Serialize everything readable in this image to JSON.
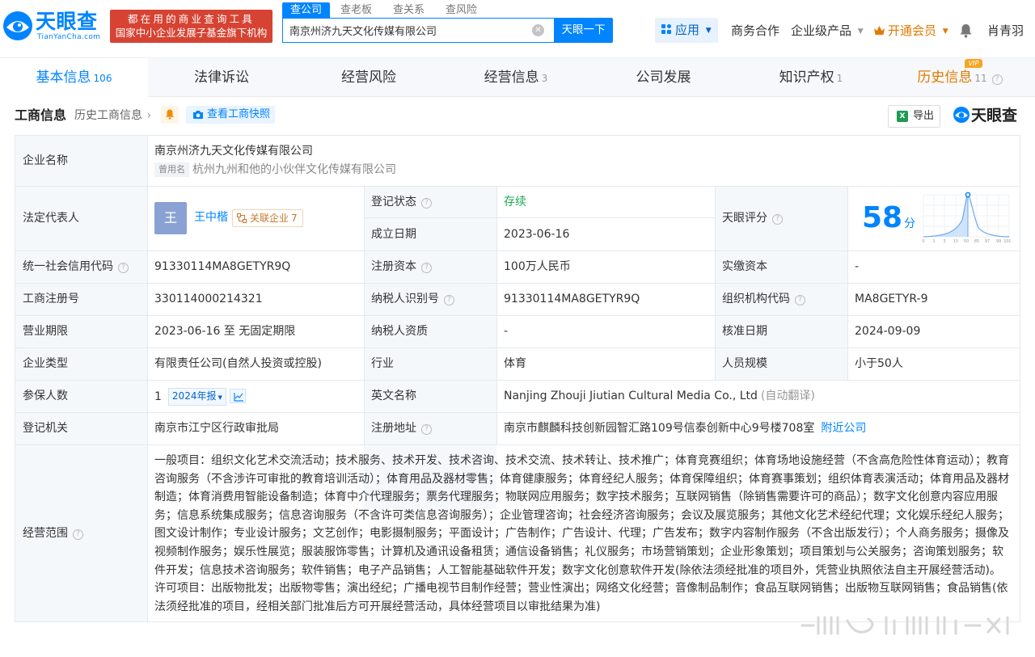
{
  "header": {
    "logo_text": "天眼查",
    "logo_sub": "TianYanCha.com",
    "slogan_line1": "都在用的商业查询工具",
    "slogan_line2": "国家中小企业发展子基金旗下机构",
    "search_tabs": [
      "查公司",
      "查老板",
      "查关系",
      "查风险"
    ],
    "search_value": "南京州济九天文化传媒有限公司",
    "search_button": "天眼一下",
    "nav": {
      "apps": "应用",
      "business": "商务合作",
      "enterprise": "企业级产品",
      "vip": "开通会员",
      "user": "肖青羽"
    }
  },
  "tabs": [
    {
      "label": "基本信息",
      "count": "106"
    },
    {
      "label": "法律诉讼",
      "count": ""
    },
    {
      "label": "经营风险",
      "count": ""
    },
    {
      "label": "经营信息",
      "count": "3"
    },
    {
      "label": "公司发展",
      "count": ""
    },
    {
      "label": "知识产权",
      "count": "1"
    },
    {
      "label": "历史信息",
      "count": "11"
    }
  ],
  "vip_badge": "VIP",
  "section": {
    "title": "工商信息",
    "history": "历史工商信息",
    "snapshot": "查看工商快照",
    "export": "导出",
    "export_icon": "X",
    "brand": "天眼查"
  },
  "info": {
    "company_name_label": "企业名称",
    "company_name": "南京州济九天文化传媒有限公司",
    "former_name_tag": "曾用名",
    "former_name": "杭州九州和他的小伙伴文化传媒有限公司",
    "legal_rep_label": "法定代表人",
    "legal_rep_avatar": "王",
    "legal_rep": "王中楷",
    "related_label": "关联企业",
    "related_count": "7",
    "reg_status_label": "登记状态",
    "reg_status": "存续",
    "est_date_label": "成立日期",
    "est_date": "2023-06-16",
    "score_label": "天眼评分",
    "score": "58",
    "score_unit": "分",
    "score_axis": [
      "0",
      "1",
      "3",
      "15",
      "50",
      "85",
      "97",
      "99",
      "100"
    ],
    "credit_code_label": "统一社会信用代码",
    "credit_code": "91330114MA8GETYR9Q",
    "reg_capital_label": "注册资本",
    "reg_capital": "100万人民币",
    "paid_capital_label": "实缴资本",
    "paid_capital": "-",
    "reg_no_label": "工商注册号",
    "reg_no": "330114000214321",
    "taxpayer_id_label": "纳税人识别号",
    "taxpayer_id": "91330114MA8GETYR9Q",
    "org_code_label": "组织机构代码",
    "org_code": "MA8GETYR-9",
    "term_label": "营业期限",
    "term": "2023-06-16 至 无固定期限",
    "taxpayer_qual_label": "纳税人资质",
    "taxpayer_qual": "-",
    "approval_date_label": "核准日期",
    "approval_date": "2024-09-09",
    "type_label": "企业类型",
    "type": "有限责任公司(自然人投资或控股)",
    "industry_label": "行业",
    "industry": "体育",
    "staff_label": "人员规模",
    "staff": "小于50人",
    "insured_label": "参保人数",
    "insured": "1",
    "insured_report": "2024年报",
    "english_label": "英文名称",
    "english": "Nanjing Zhouji Jiutian Cultural Media Co., Ltd",
    "english_note": "(自动翻译)",
    "authority_label": "登记机关",
    "authority": "南京市江宁区行政审批局",
    "address_label": "注册地址",
    "address": "南京市麒麟科技创新园智汇路109号信泰创新中心9号楼708室",
    "nearby": "附近公司",
    "scope_label": "经营范围",
    "scope": "一般项目：组织文化艺术交流活动；技术服务、技术开发、技术咨询、技术交流、技术转让、技术推广；体育竞赛组织；体育场地设施经营（不含高危险性体育运动）；教育咨询服务（不含涉许可审批的教育培训活动）；体育用品及器材零售；体育健康服务；体育经纪人服务；体育保障组织；体育赛事策划；组织体育表演活动；体育用品及器材制造；体育消费用智能设备制造；体育中介代理服务；票务代理服务；物联网应用服务；数字技术服务；互联网销售（除销售需要许可的商品）；数字文化创意内容应用服务；信息系统集成服务；信息咨询服务（不含许可类信息咨询服务）；企业管理咨询；社会经济咨询服务；会议及展览服务；其他文化艺术经纪代理；文化娱乐经纪人服务；图文设计制作；专业设计服务；文艺创作；电影摄制服务；平面设计；广告制作；广告设计、代理；广告发布；数字内容制作服务（不含出版发行）；个人商务服务；摄像及视频制作服务；娱乐性展览；服装服饰零售；计算机及通讯设备租赁；通信设备销售；礼仪服务；市场营销策划；企业形象策划；项目策划与公关服务；咨询策划服务；软件开发；信息技术咨询服务；软件销售；电子产品销售；人工智能基础软件开发；数字文化创意软件开发(除依法须经批准的项目外，凭营业执照依法自主开展经营活动)。许可项目：出版物批发；出版物零售；演出经纪；广播电视节目制作经营；营业性演出；网络文化经营；音像制品制作；食品互联网销售；出版物互联网销售；食品销售(依法须经批准的项目，经相关部门批准后方可开展经营活动，具体经营项目以审批结果为准)"
  },
  "colors": {
    "brand_blue": "#0084ff",
    "slogan_red": "#d64333",
    "status_green": "#1fa84f",
    "vip_orange": "#e07b00"
  },
  "icons": [
    "logo-eye-icon",
    "clear-icon",
    "apps-grid-icon",
    "chevron-down-icon",
    "crown-icon",
    "bell-icon",
    "chevron-right-icon",
    "camera-icon",
    "excel-icon",
    "help-icon",
    "network-icon",
    "trend-icon"
  ]
}
